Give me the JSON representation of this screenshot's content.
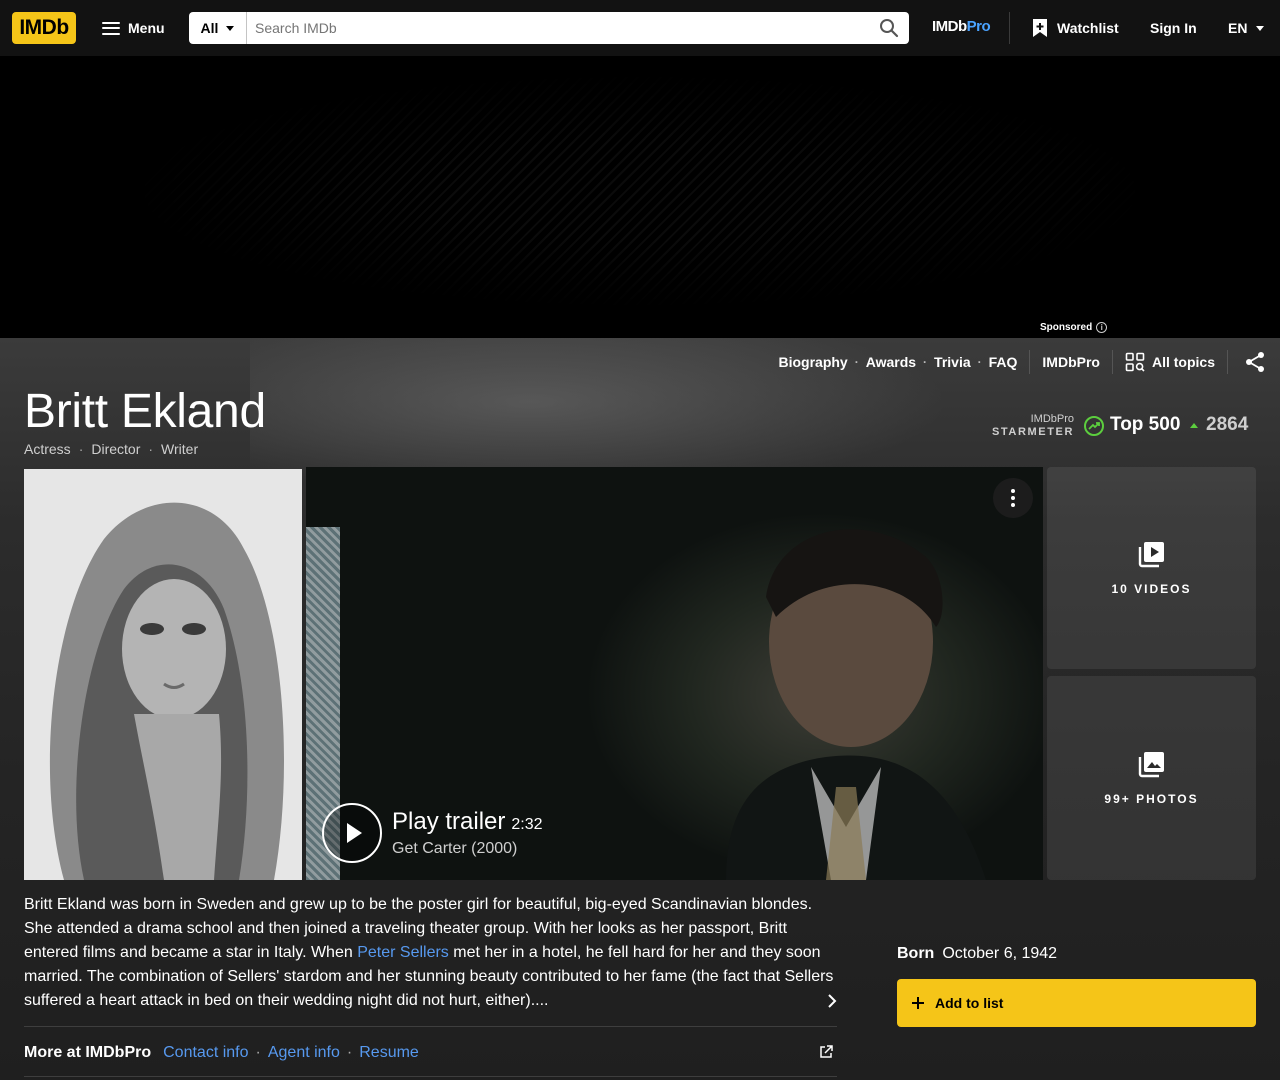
{
  "nav": {
    "logo": "IMDb",
    "menu_label": "Menu",
    "search_category": "All",
    "search_placeholder": "Search IMDb",
    "search_value": "",
    "imdbpro_a": "IMDb",
    "imdbpro_b": "Pro",
    "watchlist_label": "Watchlist",
    "signin_label": "Sign In",
    "lang_label": "EN"
  },
  "ad": {
    "sponsored_label": "Sponsored",
    "info_glyph": "i"
  },
  "subnav": {
    "items": [
      "Biography",
      "Awards",
      "Trivia",
      "FAQ"
    ],
    "imdbpro": "IMDbPro",
    "all_topics": "All topics"
  },
  "person": {
    "name": "Britt Ekland",
    "roles": [
      "Actress",
      "Director",
      "Writer"
    ]
  },
  "starmeter": {
    "label_top": "IMDbPro",
    "label_bottom": "STARMETER",
    "rank": "Top 500",
    "delta": "2864",
    "accent": "#5cce3e"
  },
  "trailer": {
    "play_label": "Play trailer",
    "duration": "2:32",
    "subtitle": "Get Carter (2000)"
  },
  "media": {
    "videos_label": "10 VIDEOS",
    "photos_label": "99+ PHOTOS"
  },
  "bio": {
    "part1": "Britt Ekland was born in Sweden and grew up to be the poster girl for beautiful, big-eyed Scandinavian blondes. She attended a drama school and then joined a traveling theater group. With her looks as her passport, Britt entered films and became a star in Italy. When ",
    "link": "Peter Sellers",
    "part2": " met her in a hotel, he fell hard for her and they soon married. The combination of Sellers' stardom and her stunning beauty contributed to her fame (the fact that Sellers suffered a heart attack in bed on their wedding night did not hurt, either)...."
  },
  "more_pro": {
    "label": "More at IMDbPro",
    "links": [
      "Contact info",
      "Agent info",
      "Resume"
    ]
  },
  "born": {
    "label": "Born",
    "date": "October 6, 1942"
  },
  "add_to_list": "Add to list",
  "colors": {
    "brand": "#f5c518",
    "link": "#5799ef",
    "background": "#1f1f1f"
  }
}
